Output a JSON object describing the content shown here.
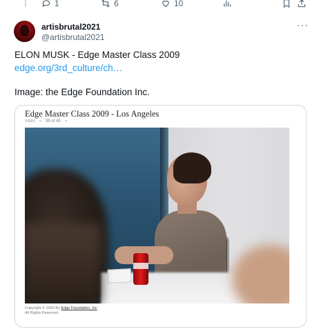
{
  "actions": {
    "reply_count": "1",
    "retweet_count": "6",
    "like_count": "10"
  },
  "tweet": {
    "display_name": "artisbrutal2021",
    "handle": "@artisbrutal2021",
    "more_label": "···",
    "line1": "ELON MUSK - Edge Master Class 2009",
    "link": "edge.org/3rd_culture/ch…",
    "line3": "Image: the Edge Foundation Inc."
  },
  "media": {
    "title": "Edge Master Class 2009 - Los Angeles",
    "nav_index": "Index",
    "nav_prev": "«",
    "nav_count": "39 of 45",
    "nav_next": "»",
    "copyright_prefix": "Copyright © 2009 By",
    "copyright_org": "Edge Foundation, Inc",
    "rights": "All Rights Reserved."
  },
  "colors": {
    "link": "#1d9bf0",
    "muted": "#536471"
  }
}
